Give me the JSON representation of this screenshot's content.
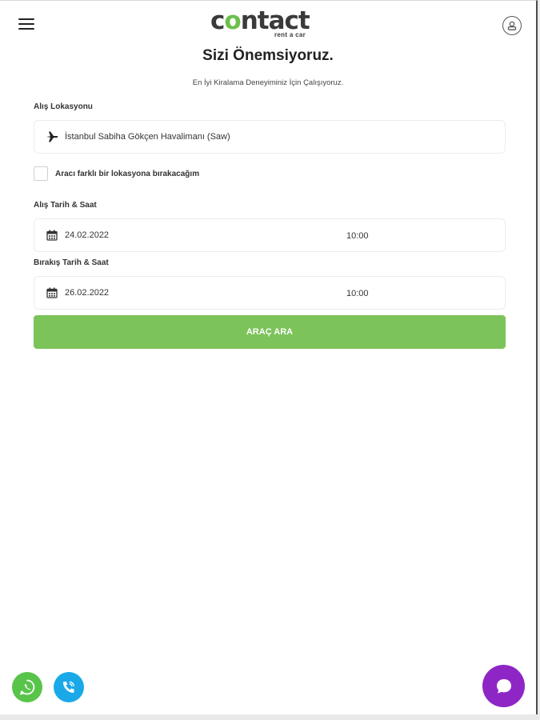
{
  "header": {
    "logo_text_pre": "c",
    "logo_text_o": "o",
    "logo_text_post": "ntact",
    "logo_tagline": "rent a car"
  },
  "hero": {
    "title": "Sizi Önemsiyoruz.",
    "subtitle": "En İyi Kiralama Deneyiminiz İçin Çalışıyoruz."
  },
  "pickup_location": {
    "label": "Alış Lokasyonu",
    "value": "İstanbul Sabiha Gökçen Havalimanı (Saw)",
    "icon": "airplane-icon"
  },
  "different_return": {
    "label": "Aracı farklı bir lokasyona bırakacağım",
    "checked": false
  },
  "pickup_datetime": {
    "label": "Alış Tarih & Saat",
    "date": "24.02.2022",
    "time": "10:00"
  },
  "return_datetime": {
    "label": "Bırakış Tarih & Saat",
    "date": "26.02.2022",
    "time": "10:00"
  },
  "search_button": {
    "label": "ARAÇ ARA"
  },
  "colors": {
    "accent_green": "#7cc35a",
    "whatsapp_green": "#58c44a",
    "phone_blue": "#1aa9e8",
    "chat_purple": "#8e26c6"
  }
}
